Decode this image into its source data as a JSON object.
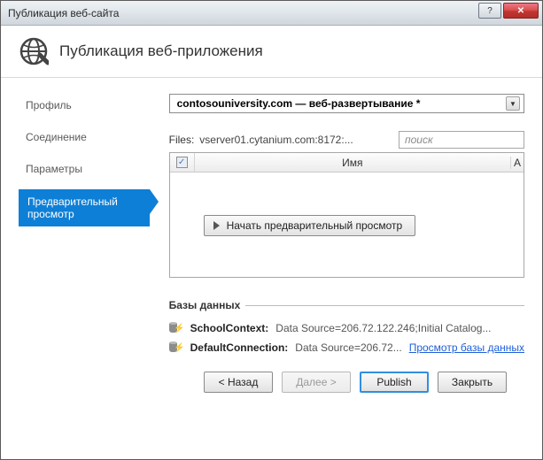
{
  "window": {
    "title": "Публикация веб-сайта"
  },
  "header": {
    "title": "Публикация веб-приложения"
  },
  "sidebar": {
    "items": [
      {
        "label": "Профиль"
      },
      {
        "label": "Соединение"
      },
      {
        "label": "Параметры"
      },
      {
        "label": "Предварительный просмотр"
      }
    ],
    "activeIndex": 3
  },
  "profile": {
    "selected": "contosouniversity.com — веб-развертывание *"
  },
  "files": {
    "label": "Files:",
    "value": "vserver01.cytanium.com:8172:...",
    "search_placeholder": "поиск"
  },
  "grid": {
    "cols": {
      "name": "Имя",
      "last": "А"
    }
  },
  "preview": {
    "button_label": "Начать предварительный просмотр"
  },
  "databases": {
    "legend": "Базы данных",
    "rows": [
      {
        "name": "SchoolContext:",
        "value": "Data Source=206.72.122.246;Initial Catalog...",
        "link": ""
      },
      {
        "name": "DefaultConnection:",
        "value": "Data Source=206.72...",
        "link": "Просмотр базы данных"
      }
    ]
  },
  "footer": {
    "back": "< Назад",
    "next": "Далее >",
    "publish": "Publish",
    "close": "Закрыть"
  }
}
